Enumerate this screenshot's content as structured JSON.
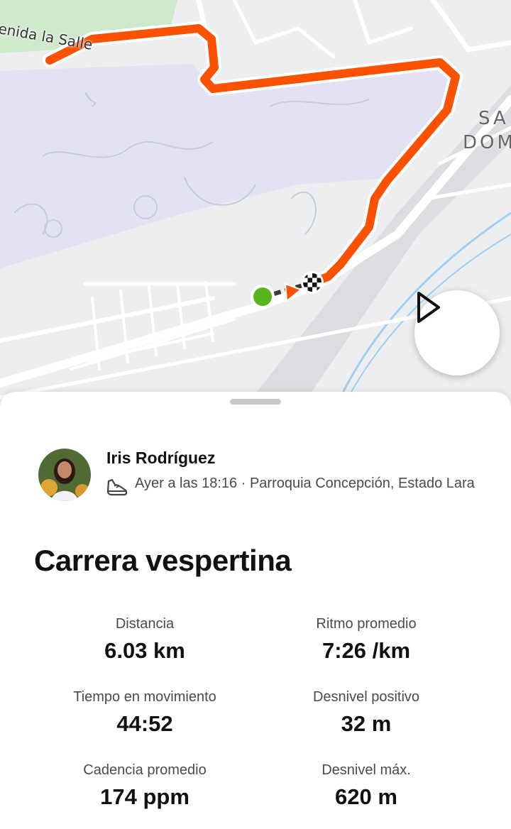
{
  "map": {
    "street_label": "enida la Salle",
    "area_label_line1": "SA",
    "area_label_line2": "DOM",
    "play_icon": "play-triangle-icon",
    "colors": {
      "route": "#fc5200",
      "start_marker": "#59b51d",
      "airport_zone": "#e2e2f3"
    }
  },
  "athlete": {
    "name": "Iris Rodríguez",
    "activity_icon": "running-shoe-icon",
    "meta": "Ayer a las 18:16 · Parroquia Concepción, Estado Lara"
  },
  "activity": {
    "title": "Carrera vespertina",
    "stats": [
      {
        "label": "Distancia",
        "value": "6.03 km"
      },
      {
        "label": "Ritmo promedio",
        "value": "7:26 /km"
      },
      {
        "label": "Tiempo en movimiento",
        "value": "44:52"
      },
      {
        "label": "Desnivel positivo",
        "value": "32 m"
      },
      {
        "label": "Cadencia promedio",
        "value": "174 ppm"
      },
      {
        "label": "Desnivel máx.",
        "value": "620 m"
      }
    ]
  }
}
